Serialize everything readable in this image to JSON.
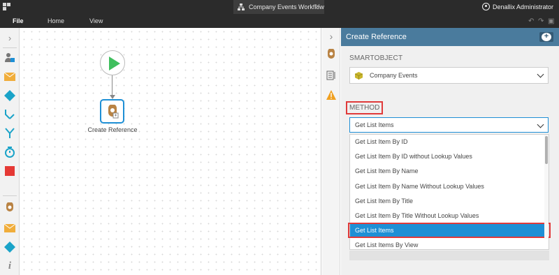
{
  "titlebar": {
    "tab_title": "Company Events Workflow",
    "tab_close": "✕",
    "user_name": "Denallix Administrator"
  },
  "menu": {
    "file": "File",
    "home": "Home",
    "view": "View"
  },
  "toolbox": {
    "items": [
      "user-task-icon",
      "email-icon",
      "decision-icon",
      "merge-icon",
      "split-icon",
      "timer-icon",
      "end-icon",
      "smartobject-icon",
      "email-icon",
      "decision-icon",
      "info-icon"
    ]
  },
  "canvas": {
    "step_label": "Create Reference"
  },
  "panel": {
    "header_title": "Create Reference",
    "smartobject_label": "SMARTOBJECT",
    "smartobject_value": "Company Events",
    "method_label": "METHOD",
    "method_value": "Get List Items",
    "options": [
      "Get List Item By ID",
      "Get List Item By ID without Lookup Values",
      "Get List Item By Name",
      "Get List Item By Name Without Lookup Values",
      "Get List Item By Title",
      "Get List Item By Title Without Lookup Values",
      "Get List Items",
      "Get List Items By View"
    ],
    "selected_index": 6
  },
  "colors": {
    "header_blue": "#4a7b9d",
    "accent_blue": "#1e8fd5",
    "highlight_red": "#e03a3a",
    "start_green": "#3fbf5e"
  }
}
